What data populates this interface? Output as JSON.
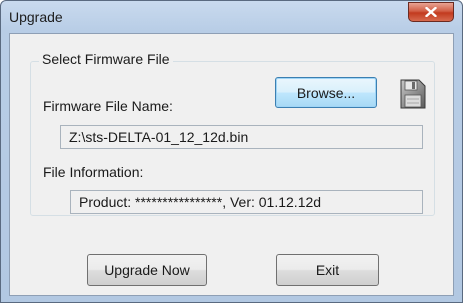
{
  "window": {
    "title": "Upgrade"
  },
  "group": {
    "legend": "Select Firmware File",
    "browse_label": "Browse...",
    "file_name_label": "Firmware File Name:",
    "file_name_value": "Z:\\sts-DELTA-01_12_12d.bin",
    "file_info_label": "File Information:",
    "file_info_value": "Product: ****************, Ver: 01.12.12d"
  },
  "actions": {
    "upgrade_label": "Upgrade Now",
    "exit_label": "Exit"
  },
  "icons": {
    "close": "close-icon",
    "disk": "floppy-disk-icon"
  }
}
